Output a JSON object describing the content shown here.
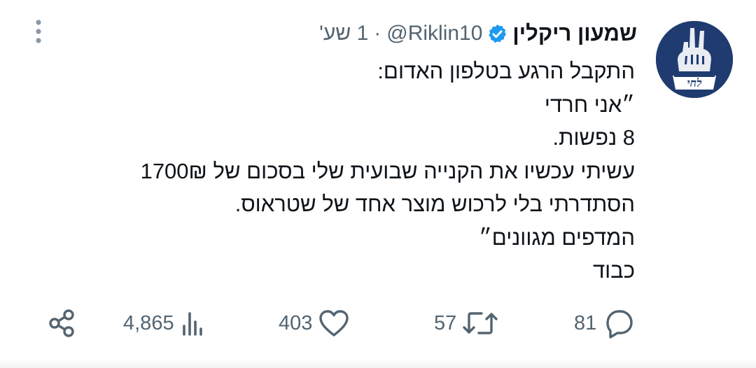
{
  "tweet": {
    "author": {
      "display_name": "שמעון ריקלין",
      "handle": "@Riklin10",
      "verified": true,
      "avatar_text": "לחי"
    },
    "separator": "·",
    "time": "1 שע'",
    "lines": [
      "התקבל הרגע בטלפון האדום:",
      "״אני חרדי",
      "8 נפשות.",
      "עשיתי עכשיו את הקנייה שבועית שלי בסכום של 1700₪",
      "הסתדרתי בלי לרכוש מוצר אחד של שטראוס.",
      "המדפים מגוונים״",
      "כבוד"
    ],
    "actions": {
      "replies": "81",
      "retweets": "57",
      "likes": "403",
      "views": "4,865"
    },
    "icons": {
      "more": "more-vertical-icon",
      "verified": "verified-badge-icon",
      "reply": "reply-icon",
      "retweet": "retweet-icon",
      "like": "heart-icon",
      "views": "views-bar-chart-icon",
      "share": "share-icon"
    },
    "colors": {
      "text": "#0f1419",
      "muted": "#536471",
      "verified": "#1d9bf0",
      "avatar_bg": "#1f3b70"
    }
  }
}
